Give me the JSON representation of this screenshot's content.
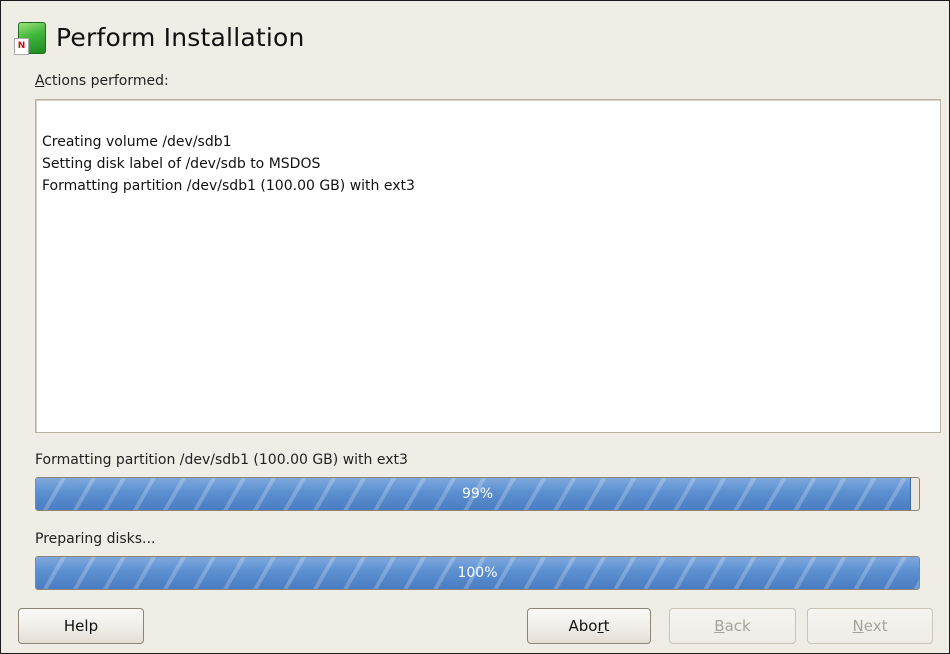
{
  "header": {
    "title": "Perform Installation",
    "icon": "yast-app-icon",
    "icon_tag": "N"
  },
  "actions": {
    "label_mnemonic": "A",
    "label_rest": "ctions performed:",
    "log": [
      "Creating volume /dev/sdb1",
      "Setting disk label of /dev/sdb to MSDOS",
      "Formatting partition /dev/sdb1 (100.00 GB) with ext3"
    ]
  },
  "progress_current": {
    "label": "Formatting partition /dev/sdb1 (100.00 GB) with ext3",
    "percent_text": "99%",
    "fraction": 0.99
  },
  "progress_total": {
    "label": "Preparing disks...",
    "percent_text": "100%",
    "fraction": 1.0
  },
  "buttons": {
    "help": "Help",
    "abort_pre": "Abo",
    "abort_mnemonic": "r",
    "abort_post": "t",
    "back_mnemonic": "B",
    "back_rest": "ack",
    "next_mnemonic": "N",
    "next_rest": "ext"
  },
  "colors": {
    "progress_fill": "#5b8fd0",
    "window_bg": "#f0ede7"
  }
}
